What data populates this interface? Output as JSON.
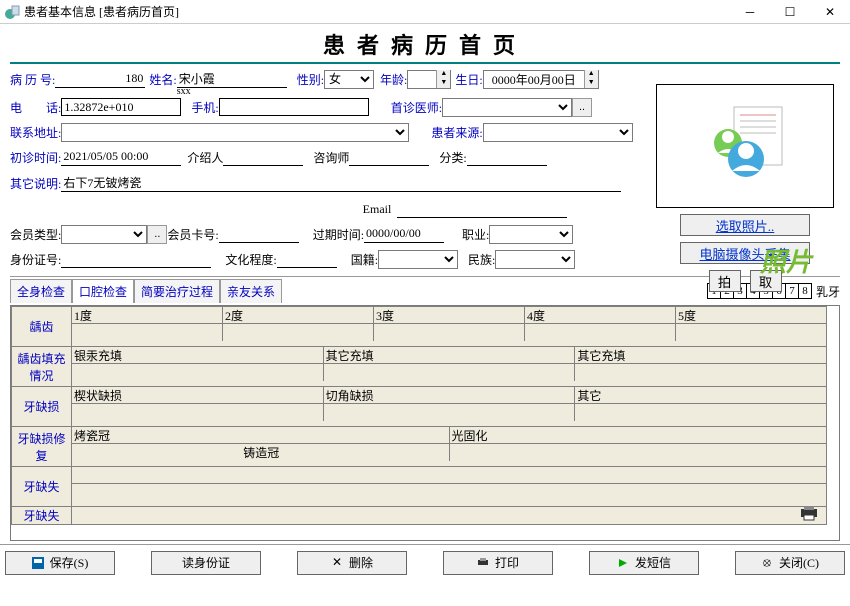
{
  "window": {
    "title": "患者基本信息   [患者病历首页]"
  },
  "page_title": "患者病历首页",
  "form": {
    "record_no_label": "病 历 号:",
    "record_no": "180",
    "name_label": "姓名:",
    "name": "宋小霞",
    "name_pinyin": "sxx",
    "gender_label": "性别:",
    "gender": "女",
    "age_label": "年龄:",
    "age": "",
    "birth_label": "生日:",
    "birth": "0000年00月00日",
    "phone_label": "电　　话:",
    "phone": "1.32872e+010",
    "mobile_label": "手机:",
    "mobile": "",
    "first_doctor_label": "首诊医师:",
    "first_doctor": "",
    "address_label": "联系地址:",
    "address": "",
    "source_label": "患者来源:",
    "source": "",
    "first_visit_label": "初诊时间:",
    "first_visit": "2021/05/05 00:00",
    "referrer_label": "介绍人",
    "referrer": "",
    "consultant_label": "咨询师",
    "consultant": "",
    "category_label": "分类:",
    "category": "",
    "notes_label": "其它说明:",
    "notes": "右下7无铍烤瓷",
    "email_label": "Email",
    "email": "",
    "member_type_label": "会员类型:",
    "member_type": "",
    "card_no_label": "会员卡号:",
    "card_no": "",
    "expire_label": "过期时间:",
    "expire": "0000/00/00",
    "occupation_label": "职业:",
    "occupation": "",
    "idcard_label": "身份证号:",
    "idcard": "",
    "education_label": "文化程度:",
    "education": "",
    "nationality_label": "国籍:",
    "nationality": "",
    "ethnicity_label": "民族:",
    "ethnicity": ""
  },
  "photo": {
    "placeholder": "照片",
    "select_btn": "选取照片..",
    "camera_btn": "电脑摄像头采集",
    "shoot_btn": "拍",
    "take_btn": "取"
  },
  "tabs": {
    "t1": "全身检查",
    "t2": "口腔检查",
    "t3": "简要治疗过程",
    "t4": "亲友关系",
    "nums": [
      "1",
      "2",
      "3",
      "4",
      "5",
      "6",
      "7",
      "8"
    ],
    "milk": "乳牙"
  },
  "grid": {
    "rows": [
      "龋齿",
      "龋齿填充情况",
      "牙缺损",
      "牙缺损修 复",
      "牙缺失",
      "牙缺失"
    ],
    "caries_degrees": [
      "1度",
      "2度",
      "3度",
      "4度",
      "5度"
    ],
    "fill_types": [
      "银汞充填",
      "其它充填",
      "其它充填"
    ],
    "defect_types": [
      "楔状缺损",
      "切角缺损",
      "其它"
    ],
    "repair_types_top": [
      "烤瓷冠",
      "光固化"
    ],
    "repair_types_bot": [
      "铸造冠"
    ]
  },
  "buttons": {
    "save": "保存(S)",
    "read_id": "读身份证",
    "delete": "删除",
    "print": "打印",
    "sms": "发短信",
    "close": "关闭(C)"
  }
}
